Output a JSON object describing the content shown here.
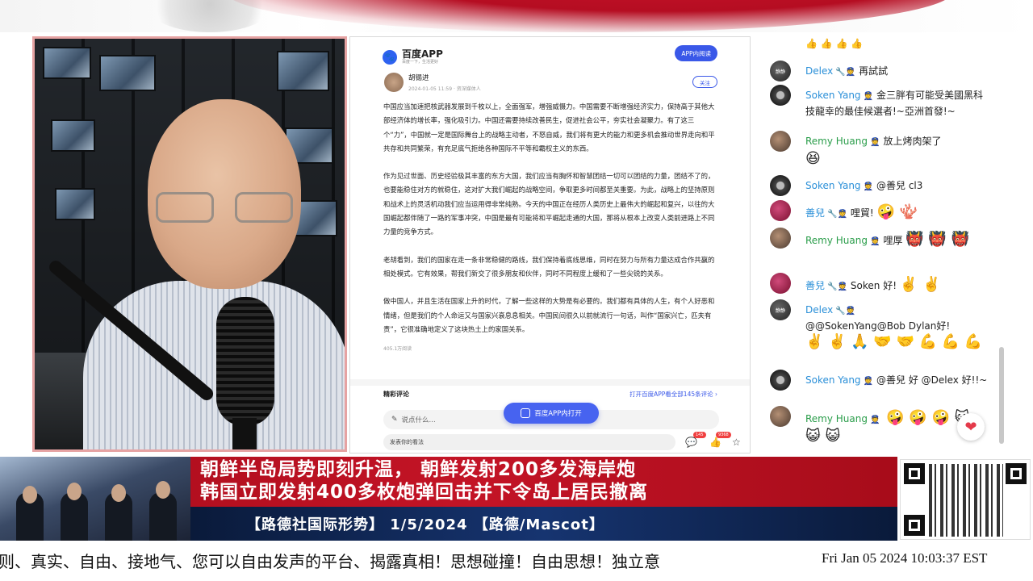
{
  "article": {
    "app_name": "百度APP",
    "app_slogan": "百度一下，生活更好",
    "open_in_app_label": "APP内阅读",
    "author": {
      "name": "胡锡进",
      "meta": "2024-01-05 11:59 · 资深媒体人"
    },
    "follow_label": "关注",
    "paragraphs": [
      "中国应当加速把核武器发展到千枚以上，全面强军，增强威慑力。中国需要不断增强经济实力，保持高于其他大部经济体的增长率，强化吸引力。中国还需要持续改善民生，促进社会公平，夯实社会凝聚力。有了这三个“力”，中国就一定是国际舞台上的战略主动者，不怒自威，我们将有更大的能力和更多机会推动世界走向和平共存和共同繁荣，有充足底气拒绝各种国际不平等和霸权主义的东西。",
      "作为见过世面、历史经验极其丰富的东方大国，我们应当有胸怀和智慧团结一切可以团结的力量，团结不了的，也要能稳住对方的就稳住，这对扩大我们崛起的战略空间，争取更多时间都至关重要。为此，战略上的坚持原则和战术上的灵活机动我们应当运用得非常纯熟。今天的中国正在经历人类历史上最伟大的崛起和复兴，以往的大国崛起都伴随了一路的军事冲突，中国是最有可能将和平崛起走通的大国，那将从根本上改变人类前进路上不同力量的竞争方式。",
      "老胡看到，我们的国家在走一条非常稳健的路线，我们保持着底线思维，同时在努力与所有力量达成合作共赢的相处模式。它有效果，帮我们新交了很多朋友和伙伴，同时不同程度上缓和了一些尖锐的关系。",
      "做中国人，并且生活在国家上升的时代，了解一些这样的大势是有必要的。我们都有具体的人生，有个人好恶和情绪，但是我们的个人命运又与国家兴衰息息相关。中国民间很久以前就流行一句话，叫作“国家兴亡，匹夫有责”，它很准确地定义了这块热土上的家国关系。"
    ],
    "read_count": "405.1万阅读",
    "comments_title": "精彩评论",
    "comments_link": "打开百度APP看全部145条评论 ›",
    "comment_placeholder": "说点什么...",
    "open_app_button": "百度APP内打开",
    "bottom_input": "发表你的看法",
    "comment_count": "145",
    "like_count": "9368"
  },
  "chat": {
    "messages": [
      {
        "name": "",
        "text": "",
        "emoji": "👍 👍 👍 👍"
      },
      {
        "name": "Delex",
        "badge": "🔧👮",
        "text": "再試試",
        "emoji": ""
      },
      {
        "name": "Soken Yang",
        "badge": "👮",
        "text": "金三胖有可能受美國黑科技龍幸的最佳候選者!~亞洲首發!~",
        "emoji": ""
      },
      {
        "name": "Remy Huang",
        "badge": "👮",
        "text": "放上烤肉架了",
        "emoji": "😆"
      },
      {
        "name": "Soken Yang",
        "badge": "👮",
        "text": "@善兒 cl3",
        "emoji": ""
      },
      {
        "name": "善兒",
        "badge": "🔧👮",
        "text": "哩貿!",
        "emoji": "🤪 🪸"
      },
      {
        "name": "Remy Huang",
        "badge": "👮",
        "text": "哩厚",
        "emoji": "👹 👹 👹"
      },
      {
        "name": "善兒",
        "badge": "🔧👮",
        "text": "Soken 好!",
        "emoji": "✌️ ✌️"
      },
      {
        "name": "Delex",
        "badge": "🔧👮",
        "text": "@@SokenYang@Bob Dylan好!",
        "emoji": "✌️ ✌️ 🙏 🤝 🤝 💪 💪 💪"
      },
      {
        "name": "Soken Yang",
        "badge": "👮",
        "text": "@善兒 好 @Delex 好!!~",
        "emoji": ""
      },
      {
        "name": "Remy Huang",
        "badge": "👮",
        "text": "",
        "emoji": "🤪 🤪 🤪 😺 😺 😺"
      }
    ]
  },
  "banner": {
    "headline_line1": "朝鲜半岛局势即刻升温，  朝鲜发射200多发海岸炮",
    "headline_line2": "韩国立即发射400多枚炮弹回击并下令岛上居民撤离",
    "subtitle": "【路德社国际形势】 1/5/2024 【路德/Mascot】"
  },
  "ticker": {
    "scroll_text": "则、真实、自由、接地气、您可以自由发声的平台、揭露真相！思想碰撞！自由思想！独立意",
    "timestamp": "Fri Jan 05 2024 10:03:37 EST"
  }
}
